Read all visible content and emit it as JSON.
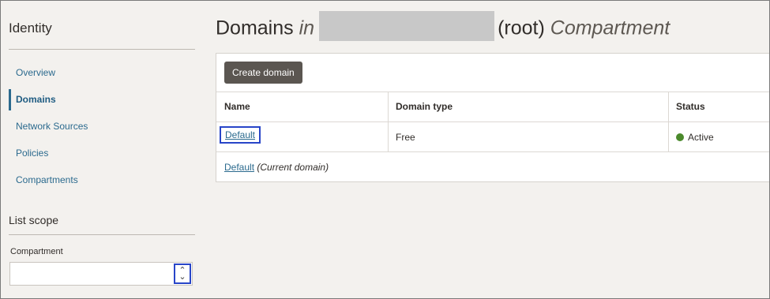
{
  "sidebar": {
    "title": "Identity",
    "items": [
      {
        "label": "Overview"
      },
      {
        "label": "Domains"
      },
      {
        "label": "Network Sources"
      },
      {
        "label": "Policies"
      },
      {
        "label": "Compartments"
      }
    ],
    "active_item": "Domains",
    "list_scope": {
      "title": "List scope",
      "compartment_label": "Compartment",
      "compartment_value": ""
    }
  },
  "main": {
    "title_prefix": "Domains",
    "title_in": "in",
    "title_root": "(root)",
    "title_suffix": "Compartment",
    "create_button": "Create domain",
    "table": {
      "columns": [
        "Name",
        "Domain type",
        "Status"
      ],
      "rows": [
        {
          "name": "Default",
          "type": "Free",
          "status": "Active"
        }
      ]
    },
    "footer": {
      "link": "Default",
      "note": "(Current domain)"
    }
  },
  "colors": {
    "link": "#2b6a8e",
    "active_status": "#4b8a2c",
    "highlight_border": "#2845c8",
    "button_bg": "#5b5651"
  }
}
